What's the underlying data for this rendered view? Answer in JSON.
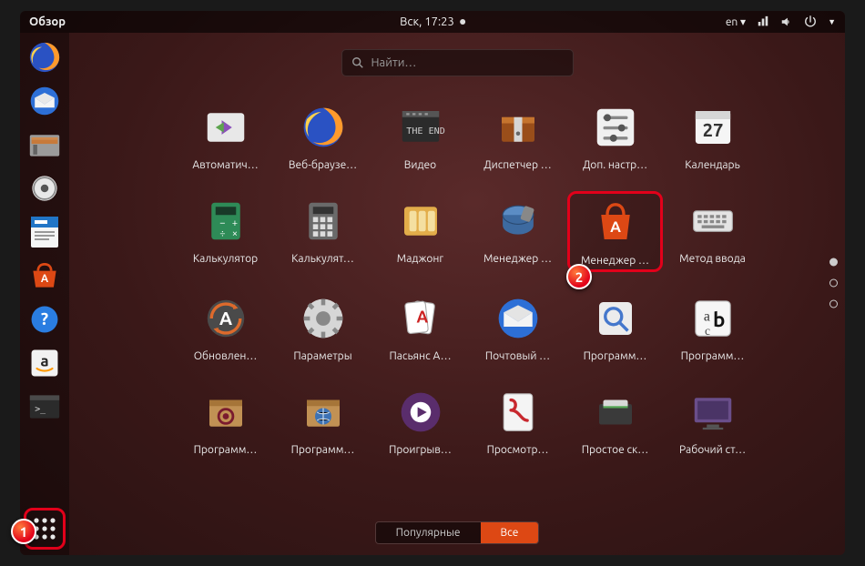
{
  "topbar": {
    "activities": "Обзор",
    "clock": "Вск, 17:23",
    "lang": "en"
  },
  "search": {
    "placeholder": "Найти…"
  },
  "dock": [
    {
      "name": "firefox-icon"
    },
    {
      "name": "thunderbird-icon"
    },
    {
      "name": "files-icon"
    },
    {
      "name": "rhythmbox-icon"
    },
    {
      "name": "libreoffice-writer-icon"
    },
    {
      "name": "ubuntu-software-icon"
    },
    {
      "name": "help-icon"
    },
    {
      "name": "amazon-icon"
    },
    {
      "name": "terminal-icon"
    }
  ],
  "apps": [
    {
      "label": "Автоматич…",
      "icon": "software-sources-icon"
    },
    {
      "label": "Веб-браузе…",
      "icon": "firefox-icon"
    },
    {
      "label": "Видео",
      "icon": "totem-icon"
    },
    {
      "label": "Диспетчер …",
      "icon": "archive-manager-icon"
    },
    {
      "label": "Доп. настр…",
      "icon": "tweaks-icon"
    },
    {
      "label": "Календарь",
      "icon": "calendar-icon",
      "day": "27"
    },
    {
      "label": "Калькулятор",
      "icon": "calculator-icon"
    },
    {
      "label": "Калькулят…",
      "icon": "calculator-alt-icon"
    },
    {
      "label": "Маджонг",
      "icon": "mahjong-icon"
    },
    {
      "label": "Менеджер …",
      "icon": "disk-utility-icon"
    },
    {
      "label": "Менеджер …",
      "icon": "ubuntu-software-icon",
      "highlight": true
    },
    {
      "label": "Метод ввода",
      "icon": "keyboard-icon"
    },
    {
      "label": "Обновлен…",
      "icon": "software-updater-icon"
    },
    {
      "label": "Параметры",
      "icon": "settings-icon"
    },
    {
      "label": "Пасьянс А…",
      "icon": "solitaire-icon"
    },
    {
      "label": "Почтовый …",
      "icon": "thunderbird-icon"
    },
    {
      "label": "Программ…",
      "icon": "magnifier-icon"
    },
    {
      "label": "Программ…",
      "icon": "font-viewer-icon"
    },
    {
      "label": "Программ…",
      "icon": "package-swirl-icon"
    },
    {
      "label": "Программ…",
      "icon": "package-globe-icon"
    },
    {
      "label": "Проигрыв…",
      "icon": "media-player-icon"
    },
    {
      "label": "Просмотр…",
      "icon": "atril-viewer-icon"
    },
    {
      "label": "Простое ск…",
      "icon": "scanner-icon"
    },
    {
      "label": "Рабочий ст…",
      "icon": "desktop-remote-icon"
    }
  ],
  "tabs": {
    "frequent": "Популярные",
    "all": "Все",
    "active": "all"
  },
  "annotations": {
    "one": "1",
    "two": "2"
  }
}
